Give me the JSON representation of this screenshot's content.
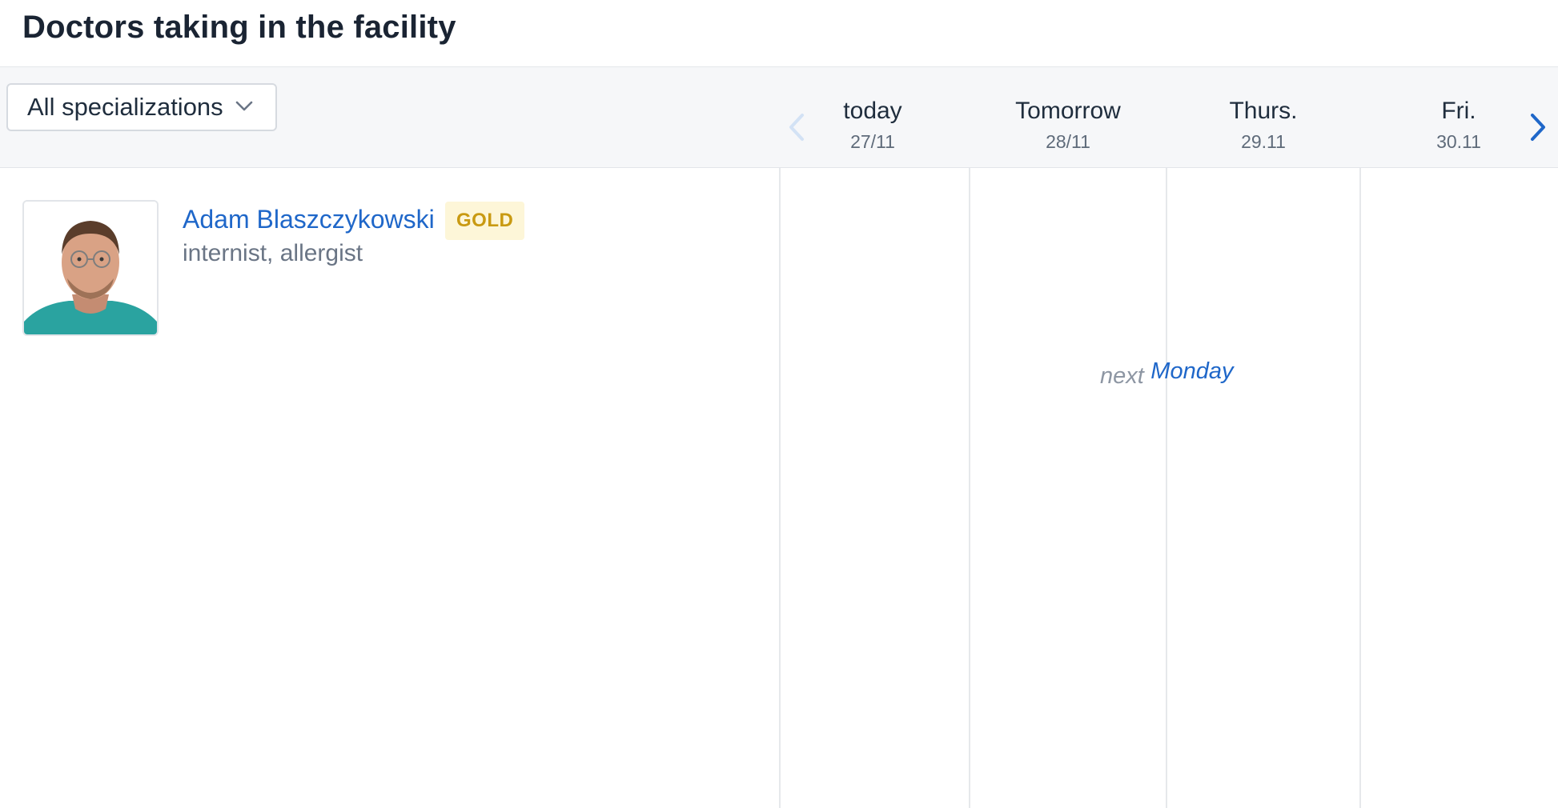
{
  "header": {
    "title": "Doctors taking in the facility"
  },
  "filter": {
    "selected": "All specializations"
  },
  "calendar": {
    "days": [
      {
        "name": "today",
        "date": "27/11"
      },
      {
        "name": "Tomorrow",
        "date": "28/11"
      },
      {
        "name": "Thurs.",
        "date": "29.11"
      },
      {
        "name": "Fri.",
        "date": "30.11"
      }
    ],
    "prev_icon": "chevron-left-icon",
    "next_icon": "chevron-right-icon"
  },
  "doctor": {
    "name": "Adam Blaszczykowski",
    "badge": "GOLD",
    "specializations": "internist, allergist"
  },
  "availability": {
    "prefix": "next",
    "day": "Monday"
  },
  "colors": {
    "accent": "#1f67c9",
    "badge_bg": "#fdf6d8",
    "badge_text": "#c99a12",
    "toolbar_bg": "#f6f7f9"
  }
}
